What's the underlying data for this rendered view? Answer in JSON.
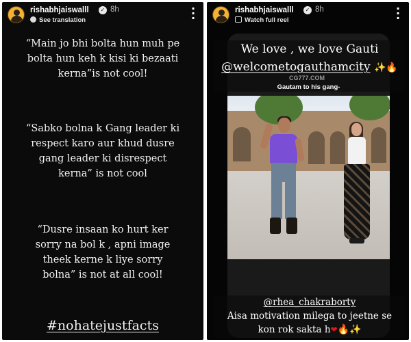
{
  "left_story": {
    "username": "rishabhjaiswalll",
    "timestamp": "8h",
    "see_translation_label": "See translation",
    "quotes": [
      {
        "lines": [
          "“Main jo bhi bolta hun muh pe",
          "bolta hun keh k kisi ki bezaati",
          "kerna”is not cool!"
        ]
      },
      {
        "lines": [
          "“Sabko bolna k Gang leader ki",
          "respect karo aur khud dusre",
          "gang leader ki disrespect",
          "kerna” is not cool"
        ]
      },
      {
        "lines": [
          "“Dusre insaan ko hurt ker",
          "sorry na bol k , apni image",
          "theek kerne k liye sorry",
          "bolna” is not at all cool!"
        ]
      }
    ],
    "hashtag": "#nohatejustfacts"
  },
  "right_story": {
    "username": "rishabhjaiswalll",
    "timestamp": "8h",
    "watch_full_reel_label": "Watch full reel",
    "caption_top_line1": "We love , we love Gauti",
    "caption_top_mention": "@welcometogauthamcity",
    "video_watermark": "CG777.COM",
    "video_title": "Gautam to his gang-",
    "caption_bottom_mention": "@rhea_chakraborty",
    "caption_bottom_line2": "Aisa motivation milega to jeetne se",
    "caption_bottom_line3": "kon rok sakta h"
  },
  "icons": [
    "verified-badge-icon",
    "more-options-icon",
    "translate-icon",
    "reel-icon",
    "sparkles-icon",
    "fire-icon",
    "heart-icon"
  ],
  "colors": {
    "story_background": "#0b0b0b",
    "text": "#ffffff",
    "verified_badge": "#e8e8e8",
    "avatar_ring": "#f3b233"
  }
}
